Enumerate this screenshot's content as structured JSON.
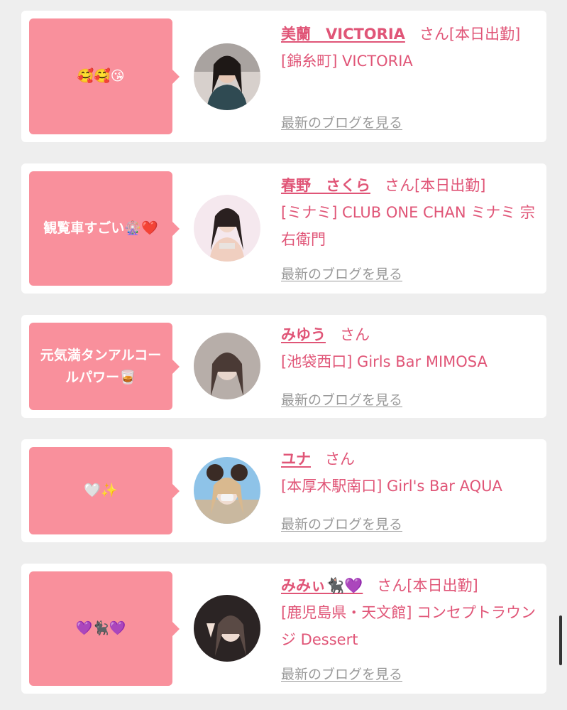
{
  "cards": [
    {
      "message": "🥰🥰😘",
      "name": "美蘭　VICTORIA",
      "honorific": "さん",
      "status": "[本日出勤]",
      "location": "[錦糸町] VICTORIA",
      "blog_link": "最新のブログを見る"
    },
    {
      "message": "観覧車すごい🎡❤️",
      "name": "春野　さくら",
      "honorific": "さん",
      "status": "[本日出勤]",
      "location": "[ミナミ] CLUB ONE CHAN ミナミ 宗右衛門",
      "blog_link": "最新のブログを見る"
    },
    {
      "message": "元気満タンアルコールパワー🥃",
      "name": "みゆう",
      "honorific": "さん",
      "status": "",
      "location": "[池袋西口] Girls Bar MIMOSA",
      "blog_link": "最新のブログを見る"
    },
    {
      "message": "🤍✨",
      "name": "ユナ",
      "honorific": "さん",
      "status": "",
      "location": "[本厚木駅南口] Girl's Bar AQUA",
      "blog_link": "最新のブログを見る"
    },
    {
      "message": "💜🐈‍⬛💜",
      "name": "みみぃ🐈‍⬛💜",
      "honorific": "さん",
      "status": "[本日出勤]",
      "location": "[鹿児島県・天文館] コンセプトラウンジ Dessert",
      "blog_link": "最新のブログを見る"
    }
  ],
  "colors": {
    "accent": "#e05577",
    "bubble": "#f9909c",
    "link_gray": "#9a9a9a",
    "background": "#eeeeee"
  },
  "icons": [
    "avatar-photo"
  ]
}
